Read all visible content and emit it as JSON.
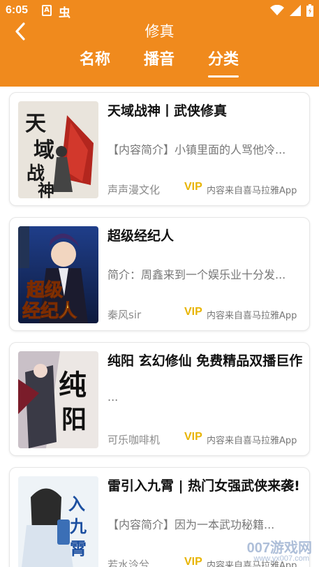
{
  "status_bar": {
    "time": "6:05",
    "a_icon": "A",
    "bug_icon": "虫"
  },
  "header": {
    "title": "修真",
    "back_icon": "chevron-left-icon"
  },
  "tabs": [
    {
      "label": "名称",
      "active": false
    },
    {
      "label": "播音",
      "active": false
    },
    {
      "label": "分类",
      "active": true
    }
  ],
  "colors": {
    "accent": "#f08a1d",
    "vip": "#e8b400"
  },
  "books": [
    {
      "title": "天域战神丨武侠修真",
      "intro": "【内容简介】小镇里面的人骂他冷...",
      "author": "声声漫文化",
      "vip": "VIP",
      "source": "内容来自喜马拉雅App"
    },
    {
      "title": "超级经纪人",
      "intro": "简介：周鑫来到一个娱乐业十分发...",
      "author": "秦风sir",
      "vip": "VIP",
      "source": "内容来自喜马拉雅App"
    },
    {
      "title": "纯阳 玄幻修仙 免费精品双播巨作",
      "intro": "...",
      "author": "可乐咖啡机",
      "vip": "VIP",
      "source": "内容来自喜马拉雅App"
    },
    {
      "title": "雷引入九霄 | 热门女强武侠来袭!",
      "intro": "【内容简介】因为一本武功秘籍...",
      "author": "若水泠兮",
      "vip": "VIP",
      "source": "内容来自喜马拉雅App"
    }
  ],
  "watermark": {
    "brand": "007游戏网",
    "url": "www.yx007.com"
  }
}
